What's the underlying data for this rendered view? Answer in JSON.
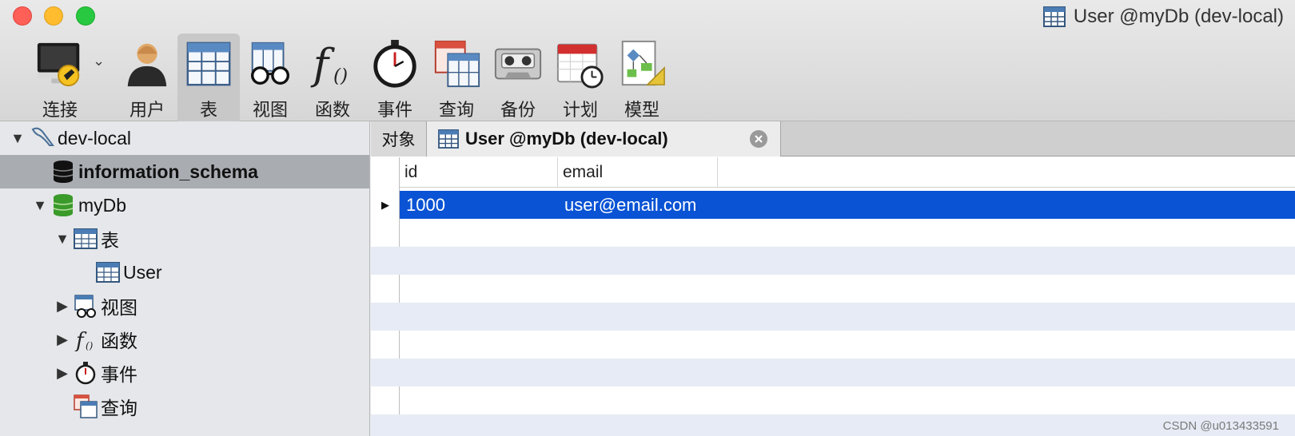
{
  "window": {
    "title": "User @myDb (dev-local)"
  },
  "toolbar": {
    "buttons": [
      {
        "label": "连接",
        "icon": "connection-icon"
      },
      {
        "label": "用户",
        "icon": "user-icon"
      },
      {
        "label": "表",
        "icon": "table-icon"
      },
      {
        "label": "视图",
        "icon": "view-icon"
      },
      {
        "label": "函数",
        "icon": "function-icon"
      },
      {
        "label": "事件",
        "icon": "event-icon"
      },
      {
        "label": "查询",
        "icon": "query-icon"
      },
      {
        "label": "备份",
        "icon": "backup-icon"
      },
      {
        "label": "计划",
        "icon": "schedule-icon"
      },
      {
        "label": "模型",
        "icon": "model-icon"
      }
    ]
  },
  "sidebar": {
    "connection": "dev-local",
    "items": [
      {
        "label": "information_schema"
      },
      {
        "label": "myDb"
      },
      {
        "label": "表"
      },
      {
        "label": "User"
      },
      {
        "label": "视图"
      },
      {
        "label": "函数"
      },
      {
        "label": "事件"
      },
      {
        "label": "查询"
      }
    ]
  },
  "tabs": {
    "objects_label": "对象",
    "active_label": "User @myDb (dev-local)"
  },
  "table": {
    "columns": [
      "id",
      "email"
    ],
    "rows": [
      {
        "id": "1000",
        "email": "user@email.com"
      }
    ]
  },
  "watermark": "CSDN @u013433591",
  "colors": {
    "selection": "#0953d4",
    "alt_row": "#e6ebf5",
    "sidebar_selected": "#a9acb1"
  }
}
